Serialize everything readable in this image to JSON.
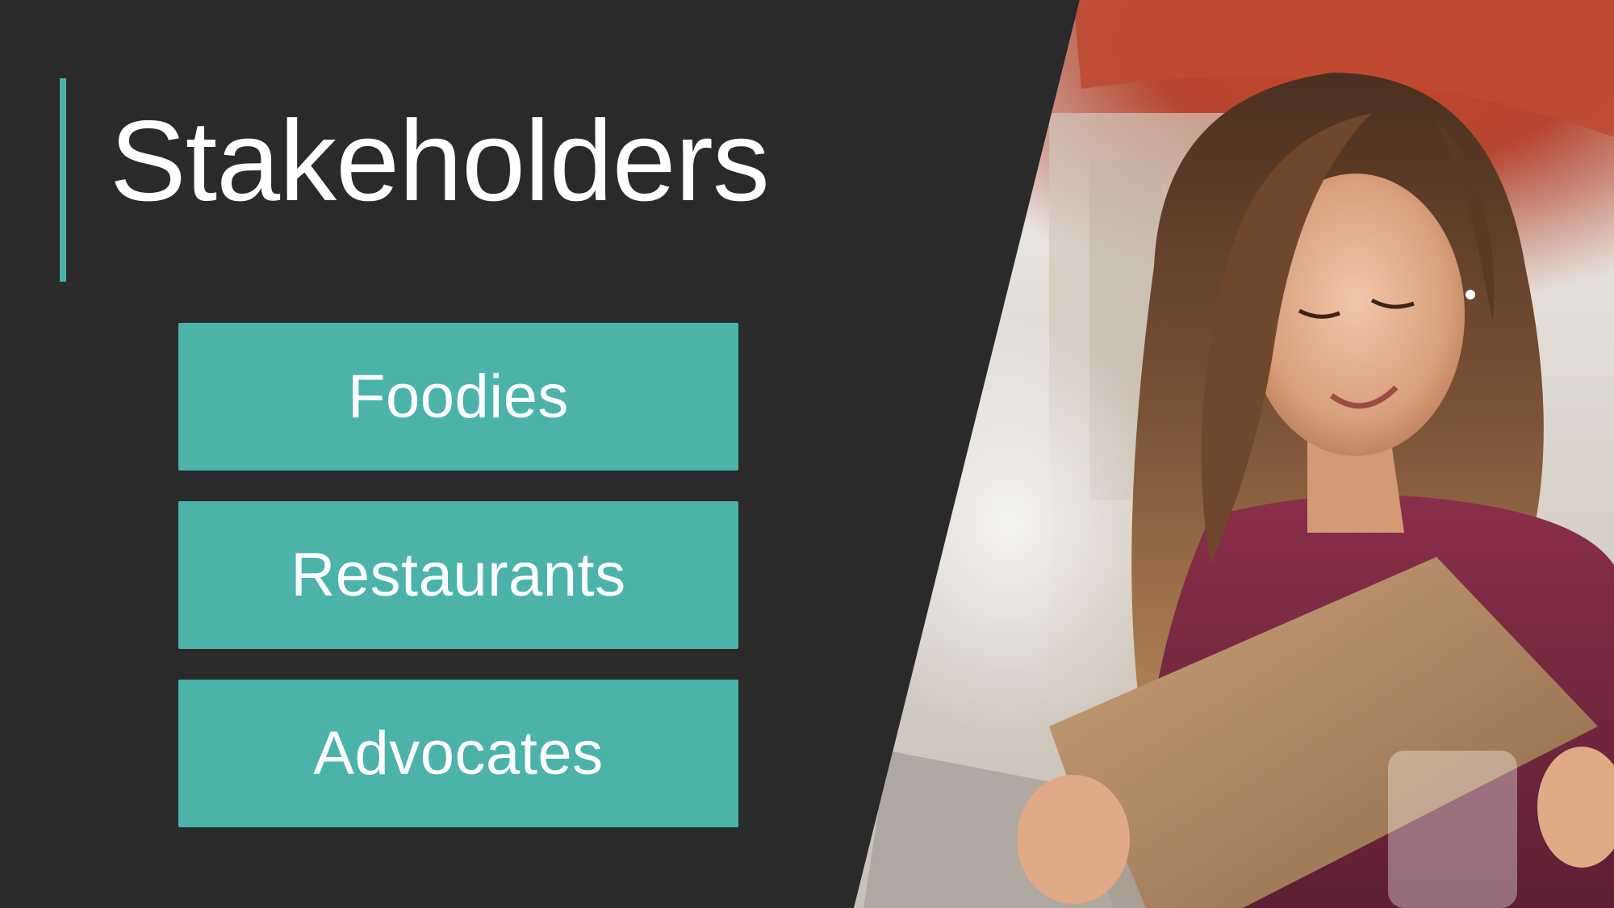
{
  "slide": {
    "title": "Stakeholders",
    "stakeholders": [
      {
        "label": "Foodies"
      },
      {
        "label": "Restaurants"
      },
      {
        "label": "Advocates"
      }
    ]
  },
  "colors": {
    "background": "#2a2a2a",
    "accent": "#4bb3a9",
    "text": "#ffffff"
  },
  "photo": {
    "subject": "smiling woman reading a menu"
  }
}
